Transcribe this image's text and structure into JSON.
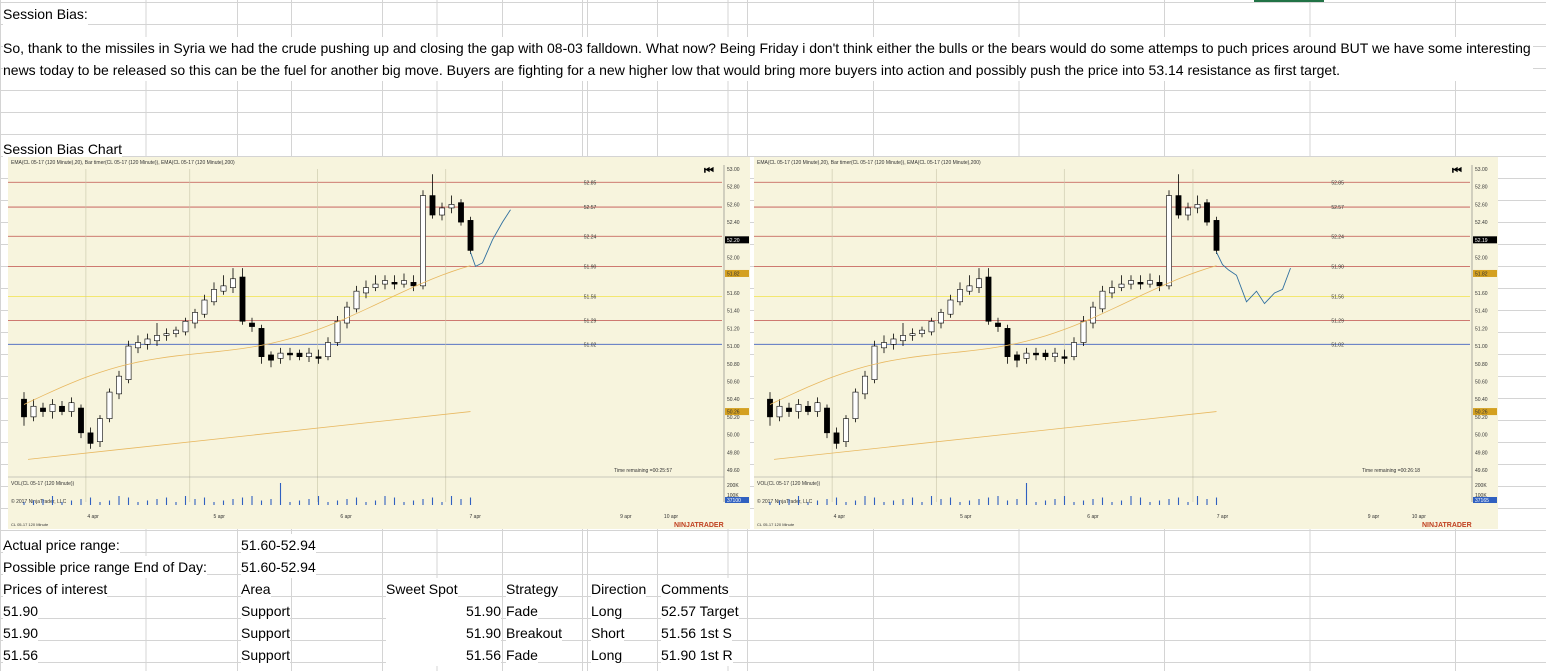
{
  "sheet": {
    "session_bias_label": "Session Bias:",
    "session_bias_text": "So, thank to the missiles in Syria we had the crude pushing up and closing the gap with 08-03 falldown. What now? Being Friday i don't think either the bulls or the bears would do some attemps to puch prices around BUT we have some interesting news today to be released so this can be the fuel for another big move. Buyers are fighting for a new higher low that would bring more buyers into action and possibly push the price into 53.14 resistance as first target.",
    "chart_label": "Session Bias Chart",
    "actual_range_label": "Actual price range:",
    "actual_range_value": "51.60-52.94",
    "possible_range_label": "Possible price range End of Day:",
    "possible_range_value": "51.60-52.94",
    "table_headers": [
      "Prices of interest",
      "Area",
      "Sweet Spot",
      "Strategy",
      "Direction",
      "Comments"
    ],
    "rows": [
      {
        "price": "51.90",
        "area": "Support",
        "sweet": "51.90",
        "strategy": "Fade",
        "direction": "Long",
        "comment": "52.57 Target"
      },
      {
        "price": "51.90",
        "area": "Support",
        "sweet": "51.90",
        "strategy": "Breakout",
        "direction": "Short",
        "comment": "51.56 1st S"
      },
      {
        "price": "51.56",
        "area": "Support",
        "sweet": "51.56",
        "strategy": "Fade",
        "direction": "Long",
        "comment": "51.90 1st R"
      }
    ]
  },
  "charts": [
    {
      "header": "EMA(CL 05-17 (120 Minute),20), Bar timer(CL 05-17 (120 Minute)), EMA(CL 05-17 (120 Minute),200)",
      "vol_label": "VOL(CL 05-17 (120 Minute))",
      "copyright": "© 2017 NinjaTrader, LLC",
      "instrument": "CL 05-17 120 Minute",
      "time_remaining": "Time remaining =00:25:57",
      "brand": "NINJATRADER",
      "price_tag": "52.20",
      "vol_tag": "37100",
      "ema_tag": "51.82",
      "ema200_tag": "50.26",
      "vol_axis": [
        "200K",
        "100K"
      ],
      "x_labels": [
        "4 apr",
        "5 apr",
        "6 apr",
        "7 apr",
        "9 apr",
        "10 apr"
      ],
      "level_labels": [
        "52.85",
        "52.57",
        "52.24",
        "51.90",
        "51.56",
        "51.29",
        "51.02"
      ],
      "y_ticks": [
        "53.00",
        "52.80",
        "52.60",
        "52.40",
        "52.20",
        "52.00",
        "51.80",
        "51.60",
        "51.40",
        "51.20",
        "51.00",
        "50.80",
        "50.60",
        "50.40",
        "50.20",
        "50.00",
        "49.80",
        "49.60"
      ]
    },
    {
      "header": "EMA(CL 05-17 (120 Minute),20), Bar timer(CL 05-17 (120 Minute)), EMA(CL 05-17 (120 Minute),200)",
      "vol_label": "VOL(CL 05-17 (120 Minute))",
      "copyright": "© 2017 NinjaTrader, LLC",
      "instrument": "CL 05-17 120 Minute",
      "time_remaining": "Time remaining =00:26:18",
      "brand": "NINJATRADER",
      "price_tag": "52.19",
      "vol_tag": "37165",
      "ema_tag": "51.82",
      "ema200_tag": "50.26",
      "vol_axis": [
        "200K",
        "100K"
      ],
      "x_labels": [
        "4 apr",
        "5 apr",
        "6 apr",
        "7 apr",
        "9 apr",
        "10 apr"
      ],
      "level_labels": [
        "52.85",
        "52.57",
        "52.24",
        "51.90",
        "51.56",
        "51.29",
        "51.02"
      ],
      "y_ticks": [
        "53.00",
        "52.80",
        "52.60",
        "52.40",
        "52.20",
        "52.00",
        "51.80",
        "51.60",
        "51.40",
        "51.20",
        "51.00",
        "50.80",
        "50.60",
        "50.40",
        "50.20",
        "50.00",
        "49.80",
        "49.60"
      ]
    }
  ],
  "colors": {
    "chart_bg": "#f7f4dd",
    "red_level": "#c0504d",
    "yellow_level": "#f2e34b",
    "blue_level": "#4060c0",
    "ema20": "#e8b860",
    "accent": "#217346"
  }
}
